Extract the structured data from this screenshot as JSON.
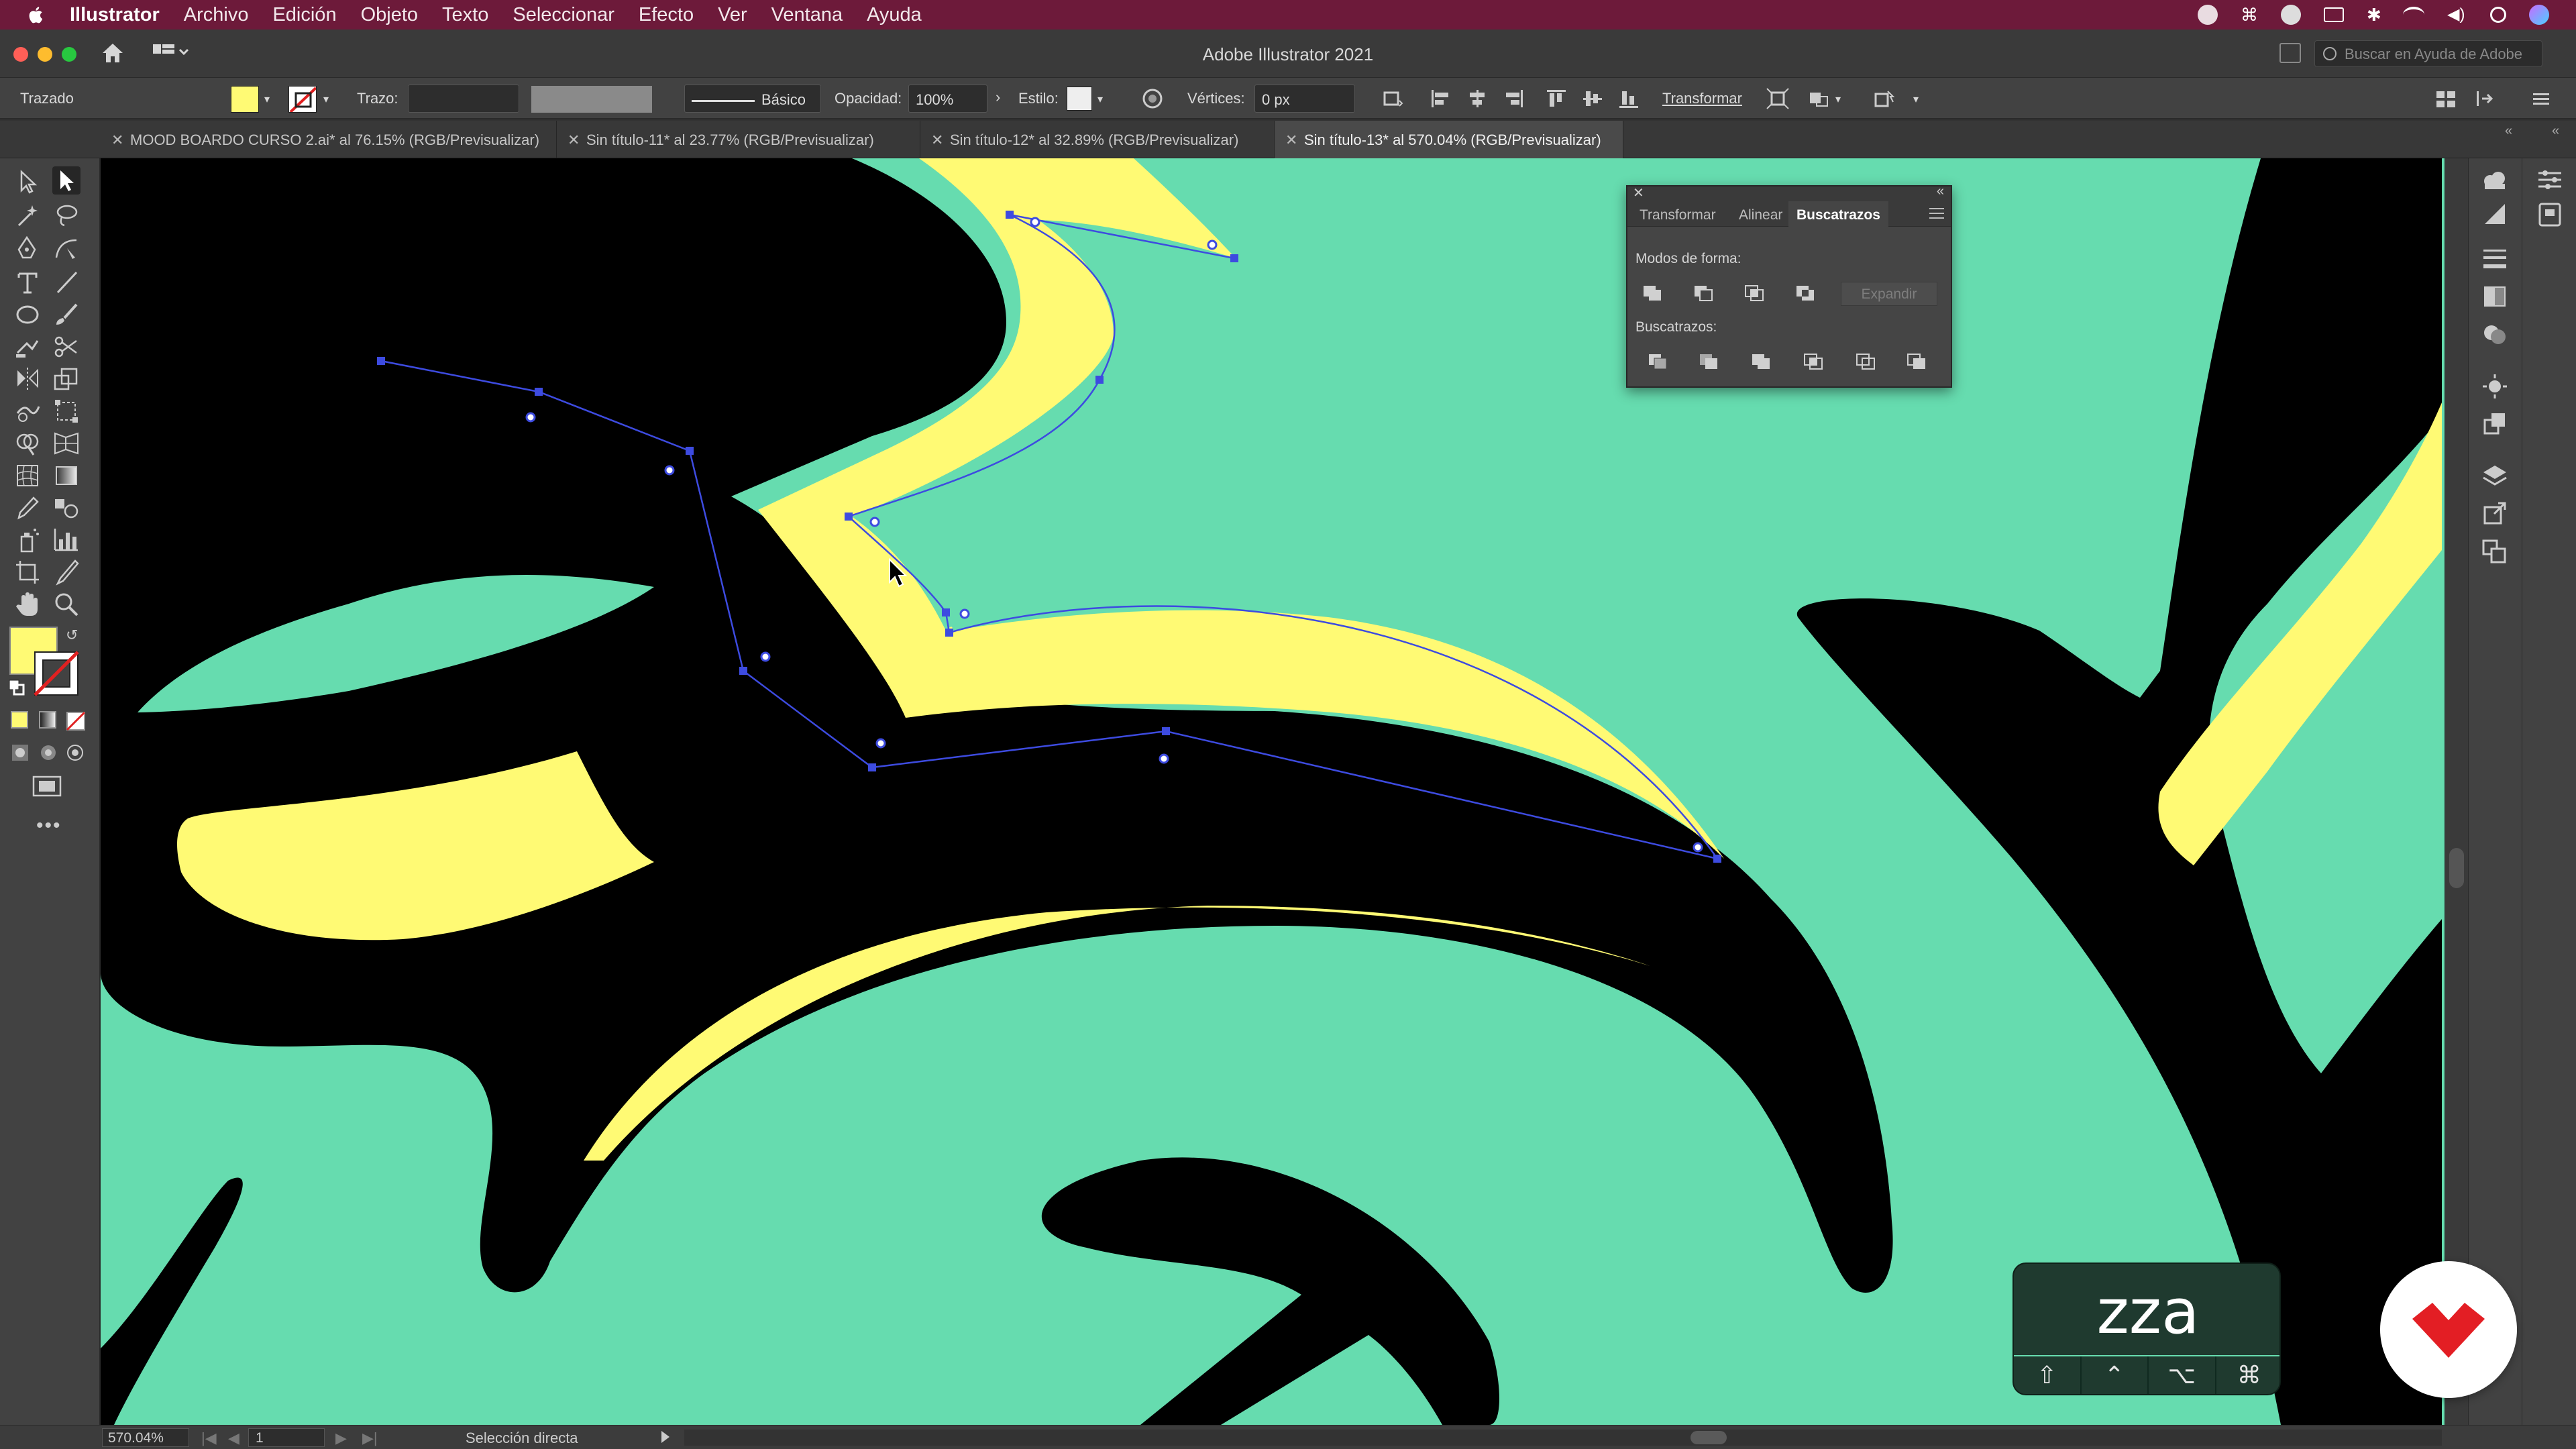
{
  "menubar": {
    "app": "Illustrator",
    "items": [
      "Archivo",
      "Edición",
      "Objeto",
      "Texto",
      "Seleccionar",
      "Efecto",
      "Ver",
      "Ventana",
      "Ayuda"
    ]
  },
  "window": {
    "title": "Adobe Illustrator 2021",
    "search_placeholder": "Buscar en Ayuda de Adobe"
  },
  "controlbar": {
    "selection_label": "Trazado",
    "stroke_label": "Trazo:",
    "brush_value": "Básico",
    "opacity_label": "Opacidad:",
    "opacity_value": "100%",
    "style_label": "Estilo:",
    "vertices_label": "Vértices:",
    "vertices_value": "0 px",
    "transform_label": "Transformar",
    "fill_color": "#fffa74"
  },
  "tabs": [
    {
      "label": "MOOD BOARDO CURSO 2.ai* al 76.15% (RGB/Previsualizar)",
      "active": false
    },
    {
      "label": "Sin título-11* al 23.77% (RGB/Previsualizar)",
      "active": false
    },
    {
      "label": "Sin título-12* al 32.89% (RGB/Previsualizar)",
      "active": false
    },
    {
      "label": "Sin título-13* al 570.04% (RGB/Previsualizar)",
      "active": true
    }
  ],
  "pathfinder": {
    "tabs": [
      "Transformar",
      "Alinear",
      "Buscatrazos"
    ],
    "shape_modes_label": "Modos de forma:",
    "pathfinders_label": "Buscatrazos:",
    "expand_label": "Expandir"
  },
  "status": {
    "zoom": "570.04%",
    "page": "1",
    "tool_mode": "Selección directa"
  },
  "keycast": {
    "keys": "zza",
    "modifiers": [
      "⇧",
      "⌃",
      "⌥",
      "⌘"
    ]
  },
  "colors": {
    "canvas_bg": "#66dcaf",
    "shape_black": "#000000",
    "shape_yellow": "#fffa74",
    "path_selection": "#3d4be0",
    "menubar": "#6d1a3a"
  }
}
